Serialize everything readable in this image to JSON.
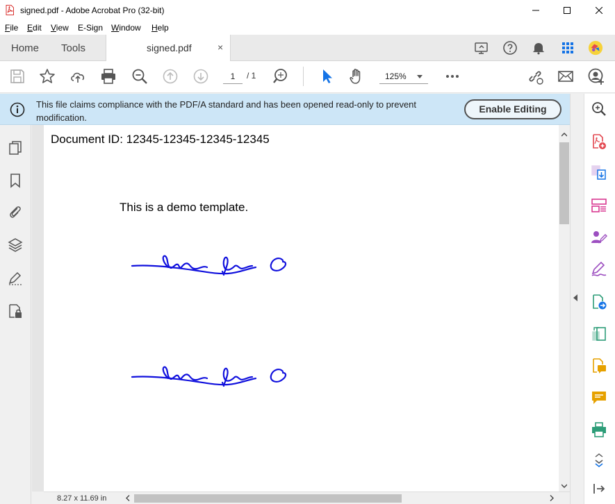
{
  "window": {
    "title": "signed.pdf - Adobe Acrobat Pro (32-bit)",
    "controls": [
      "minimize",
      "maximize",
      "close"
    ]
  },
  "menu": [
    {
      "label": "File",
      "underline": "F",
      "rest": "ile"
    },
    {
      "label": "Edit",
      "underline": "E",
      "rest": "dit"
    },
    {
      "label": "View",
      "underline": "V",
      "rest": "iew"
    },
    {
      "label": "E-Sign",
      "underline": "",
      "rest": "E-Sign"
    },
    {
      "label": "Window",
      "underline": "W",
      "rest": "indow"
    },
    {
      "label": "Help",
      "underline": "H",
      "rest": "elp"
    }
  ],
  "tabs": {
    "home": "Home",
    "tools": "Tools",
    "document": "signed.pdf",
    "close_glyph": "×"
  },
  "toolbar": {
    "page_current": "1",
    "page_total": "/ 1",
    "zoom": "125%"
  },
  "banner": {
    "message": "This file claims compliance with the PDF/A standard and has been opened read-only to prevent modification.",
    "button": "Enable Editing"
  },
  "document": {
    "doc_id": "Document ID: 12345-12345-12345-12345",
    "body_text": "This is a demo template.",
    "signatures": [
      "handwritten-signature",
      "handwritten-signature"
    ],
    "signature_color": "#1010dd"
  },
  "status": {
    "page_size": "8.27 x 11.69 in"
  },
  "colors": {
    "banner_bg": "#cde6f7",
    "accent_blue": "#1473e6",
    "tool_red": "#e34850",
    "tool_purple": "#9c4ec0",
    "tool_pink": "#d83790",
    "tool_green": "#2d9d78",
    "tool_yellow": "#e6a100"
  }
}
